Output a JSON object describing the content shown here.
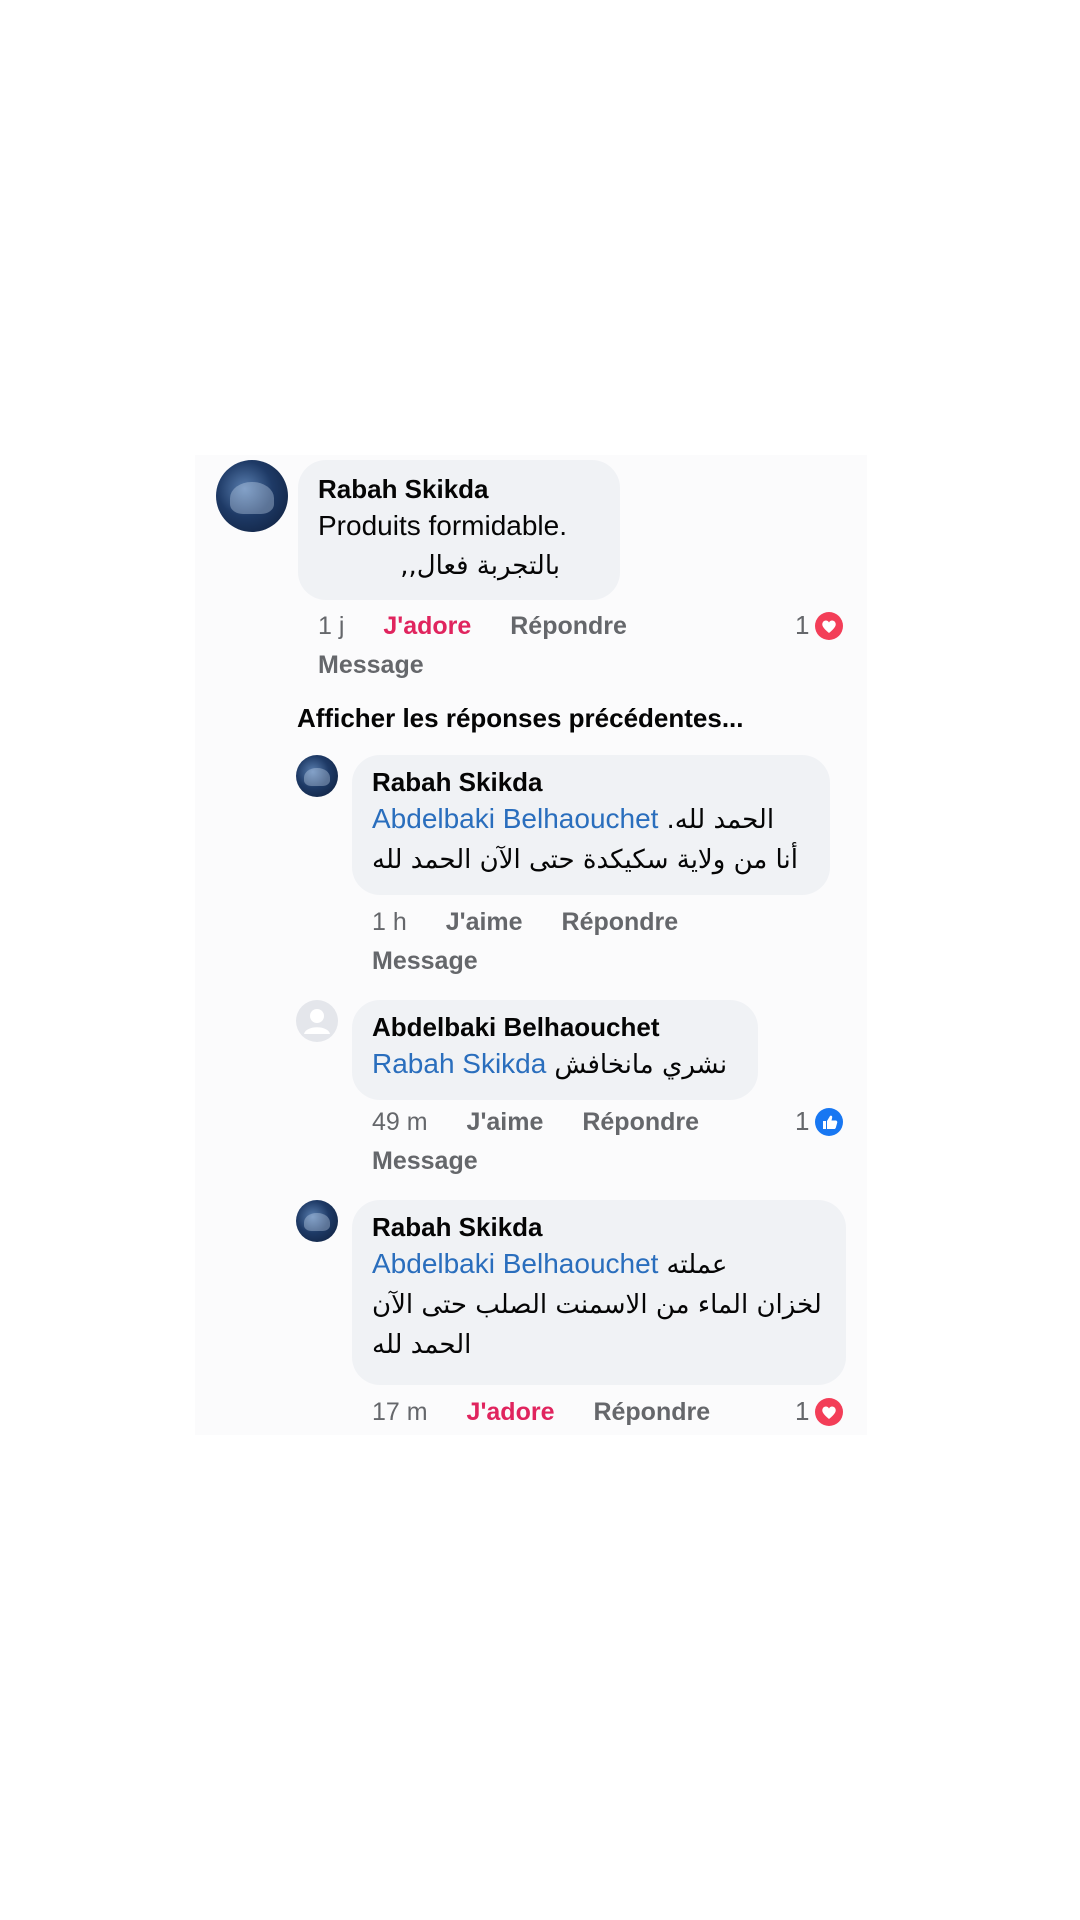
{
  "comments": [
    {
      "author": "Rabah Skikda",
      "line1": "Produits formidable.",
      "line2": "بالتجربة فعال,,",
      "time": "1 j",
      "reaction_action": "J'adore",
      "reply": "Répondre",
      "message": "Message",
      "reaction_count": "1",
      "reaction_icon": "heart-icon"
    }
  ],
  "show_previous": "Afficher les réponses précédentes...",
  "replies": [
    {
      "author": "Rabah Skikda",
      "mention": "Abdelbaki Belhaouchet",
      "text_after_mention": "الحمد لله.",
      "line2": "أنا من ولاية سكيكدة حتى الآن الحمد لله",
      "time": "1 h",
      "reaction_action": "J'aime",
      "reply": "Répondre",
      "message": "Message"
    },
    {
      "author": "Abdelbaki Belhaouchet",
      "mention": "Rabah Skikda",
      "text_after_mention": "نشري مانخافش",
      "time": "49 m",
      "reaction_action": "J'aime",
      "reply": "Répondre",
      "message": "Message",
      "reaction_count": "1",
      "reaction_icon": "like-icon"
    },
    {
      "author": "Rabah Skikda",
      "mention": "Abdelbaki Belhaouchet",
      "text_after_mention": "عملته",
      "line2": "لخزان الماء من الاسمنت الصلب حتى الآن",
      "line3": "الحمد لله",
      "time": "17 m",
      "reaction_action": "J'adore",
      "reply": "Répondre",
      "reaction_count": "1",
      "reaction_icon": "heart-icon"
    }
  ],
  "colors": {
    "mention": "#2a6ebd",
    "love": "#e0245e",
    "bubble": "#f0f2f5",
    "meta": "#65676b"
  }
}
